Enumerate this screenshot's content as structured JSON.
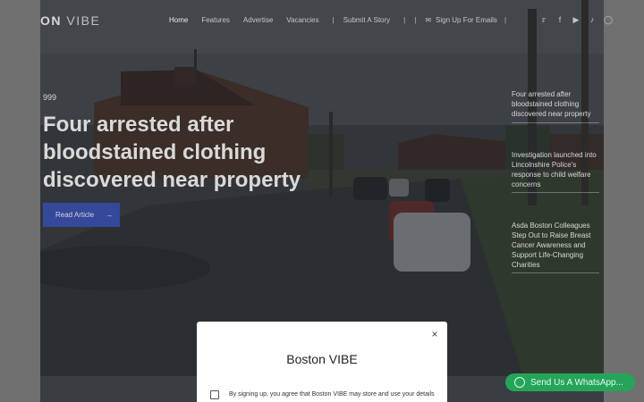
{
  "brand": {
    "logo_bold": "ON",
    "logo_thin": "VIBE"
  },
  "nav": {
    "items": [
      {
        "label": "Home",
        "active": true
      },
      {
        "label": "Features"
      },
      {
        "label": "Advertise"
      },
      {
        "label": "Vacancies"
      }
    ],
    "submit_label": "Submit A Story",
    "signup_label": "Sign Up For Emails",
    "separator": "|"
  },
  "social": {
    "icons": [
      "twitter-icon",
      "facebook-icon",
      "youtube-icon",
      "tiktok-icon",
      "instagram-icon"
    ]
  },
  "hero": {
    "category": "999",
    "headline": "Four arrested after bloodstained clothing discovered near property",
    "read_more": "Read Article",
    "arrow": "→"
  },
  "sidebar_stories": [
    {
      "title": "Four arrested after bloodstained clothing discovered near property"
    },
    {
      "title": "Investigation launched into Lincolnshire Police's response to child welfare concerns"
    },
    {
      "title": "Asda Boston Colleagues Step Out to Raise Breast Cancer Awareness and Support Life-Changing Charities"
    }
  ],
  "modal": {
    "title": "Boston VIBE",
    "close": "×",
    "consent_text": "By signing up, you agree that Boston VIBE may store and use your details"
  },
  "whatsapp": {
    "label": "Send Us A WhatsApp..."
  }
}
